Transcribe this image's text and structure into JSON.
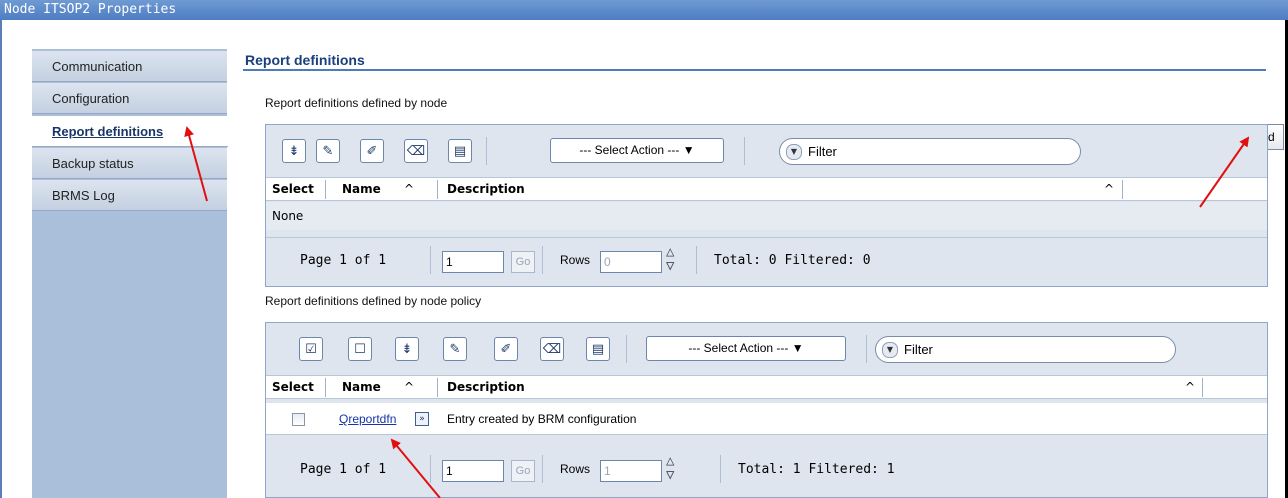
{
  "window": {
    "title": "Node ITSOP2 Properties"
  },
  "sidebar": {
    "items": [
      {
        "label": "Communication"
      },
      {
        "label": "Configuration"
      },
      {
        "label": "Report definitions"
      },
      {
        "label": "Backup status"
      },
      {
        "label": "BRMS Log"
      }
    ]
  },
  "main": {
    "title": "Report definitions",
    "add_label": "Add"
  },
  "table1": {
    "caption": "Report definitions defined by node",
    "select_action": "--- Select Action ---",
    "filter": "Filter",
    "headers": {
      "select": "Select",
      "name": "Name",
      "description": "Description"
    },
    "empty": "None",
    "pager": {
      "page": "Page 1 of 1",
      "page_value": "1",
      "go": "Go",
      "rows_label": "Rows",
      "rows_value": "0",
      "totals": "Total: 0  Filtered: 0"
    }
  },
  "table2": {
    "caption": "Report definitions defined by node policy",
    "select_action": "--- Select Action ---",
    "filter": "Filter",
    "headers": {
      "select": "Select",
      "name": "Name",
      "description": "Description"
    },
    "rows": [
      {
        "name": "Qreportdfn",
        "description": "Entry created by BRM configuration"
      }
    ],
    "pager": {
      "page": "Page 1 of 1",
      "page_value": "1",
      "go": "Go",
      "rows_label": "Rows",
      "rows_value": "1",
      "totals": "Total: 1  Filtered: 1"
    }
  },
  "colors": {
    "titlebar": "#4d7dc2",
    "sidebar": "#aabfd9",
    "panel": "#dfe5ef",
    "annotation_arrow": "#e01010"
  },
  "icons": [
    "select-all-icon",
    "deselect-all-icon",
    "expand-all-icon",
    "filter-edit-icon",
    "edit-sort-icon",
    "clear-sort-icon",
    "column-config-icon",
    "chevron-down-icon",
    "sort-ascending-icon",
    "row-action-icon"
  ]
}
